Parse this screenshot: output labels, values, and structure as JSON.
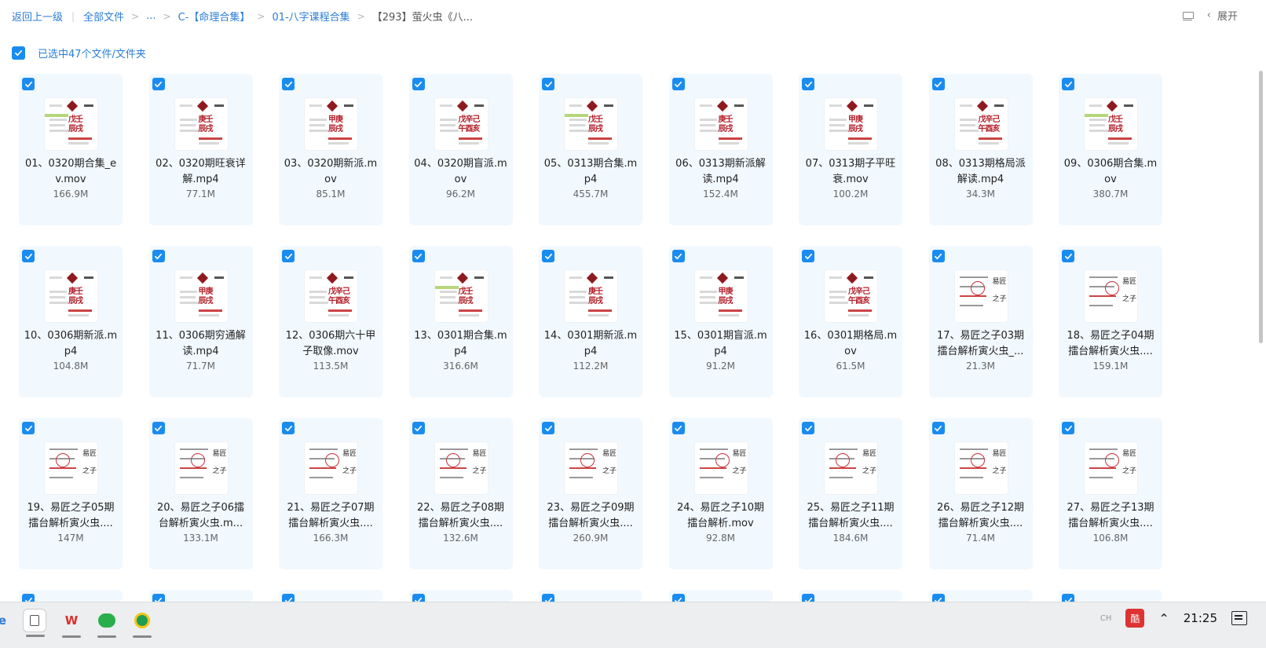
{
  "breadcrumb": {
    "back": "返回上一级",
    "root": "全部文件",
    "ellipsis": "...",
    "c_folder": "C-【命理合集】",
    "sub_folder": "01-八字课程合集",
    "current": "【293】萤火虫《八..."
  },
  "header": {
    "expand_label": "展开"
  },
  "selection": {
    "text": "已选中47个文件/文件夹"
  },
  "files": [
    {
      "name": "01、0320期合集_ev.mov",
      "size": "166.9M",
      "thumb": "table"
    },
    {
      "name": "02、0320期旺衰详解.mp4",
      "size": "77.1M",
      "thumb": "table"
    },
    {
      "name": "03、0320期新派.mov",
      "size": "85.1M",
      "thumb": "table"
    },
    {
      "name": "04、0320期盲派.mov",
      "size": "96.2M",
      "thumb": "table"
    },
    {
      "name": "05、0313期合集.mp4",
      "size": "455.7M",
      "thumb": "table"
    },
    {
      "name": "06、0313期新派解读.mp4",
      "size": "152.4M",
      "thumb": "table"
    },
    {
      "name": "07、0313期子平旺衰.mov",
      "size": "100.2M",
      "thumb": "table"
    },
    {
      "name": "08、0313期格局派解读.mp4",
      "size": "34.3M",
      "thumb": "table"
    },
    {
      "name": "09、0306期合集.mov",
      "size": "380.7M",
      "thumb": "table"
    },
    {
      "name": "10、0306期新派.mp4",
      "size": "104.8M",
      "thumb": "table"
    },
    {
      "name": "11、0306期穷通解读.mp4",
      "size": "71.7M",
      "thumb": "table"
    },
    {
      "name": "12、0306期六十甲子取像.mov",
      "size": "113.5M",
      "thumb": "table"
    },
    {
      "name": "13、0301期合集.mp4",
      "size": "316.6M",
      "thumb": "table"
    },
    {
      "name": "14、0301期新派.mp4",
      "size": "112.2M",
      "thumb": "table"
    },
    {
      "name": "15、0301期盲派.mp4",
      "size": "91.2M",
      "thumb": "table"
    },
    {
      "name": "16、0301期格局.mov",
      "size": "61.5M",
      "thumb": "table"
    },
    {
      "name": "17、易匠之子03期擂台解析寅火虫_...",
      "size": "21.3M",
      "thumb": "script"
    },
    {
      "name": "18、易匠之子04期擂台解析寅火虫....",
      "size": "159.1M",
      "thumb": "script"
    },
    {
      "name": "19、易匠之子05期擂台解析寅火虫....",
      "size": "147M",
      "thumb": "script"
    },
    {
      "name": "20、易匠之子06擂台解析寅火虫.m...",
      "size": "133.1M",
      "thumb": "script"
    },
    {
      "name": "21、易匠之子07期擂台解析寅火虫....",
      "size": "166.3M",
      "thumb": "script"
    },
    {
      "name": "22、易匠之子08期擂台解析寅火虫....",
      "size": "132.6M",
      "thumb": "script"
    },
    {
      "name": "23、易匠之子09期擂台解析寅火虫....",
      "size": "260.9M",
      "thumb": "script"
    },
    {
      "name": "24、易匠之子10期擂台解析.mov",
      "size": "92.8M",
      "thumb": "script"
    },
    {
      "name": "25、易匠之子11期擂台解析寅火虫....",
      "size": "184.6M",
      "thumb": "script"
    },
    {
      "name": "26、易匠之子12期擂台解析寅火虫....",
      "size": "71.4M",
      "thumb": "script"
    },
    {
      "name": "27、易匠之子13期擂台解析寅火虫....",
      "size": "106.8M",
      "thumb": "script"
    }
  ],
  "thumb_text": {
    "t1": "戊壬",
    "t2": "辰戌",
    "t3": "庚壬",
    "t4": "甲庚",
    "t5": "戊辛己",
    "t6": "午酉亥",
    "t7": "易匠",
    "t8": "之子"
  },
  "taskbar": {
    "clock": "21:25",
    "ime": "CH",
    "tray_badge": "酷"
  },
  "colors": {
    "accent": "#1a8cf0",
    "link": "#2c7ed6",
    "card_bg": "#f1f8fe",
    "ink_red": "#b4202a"
  }
}
